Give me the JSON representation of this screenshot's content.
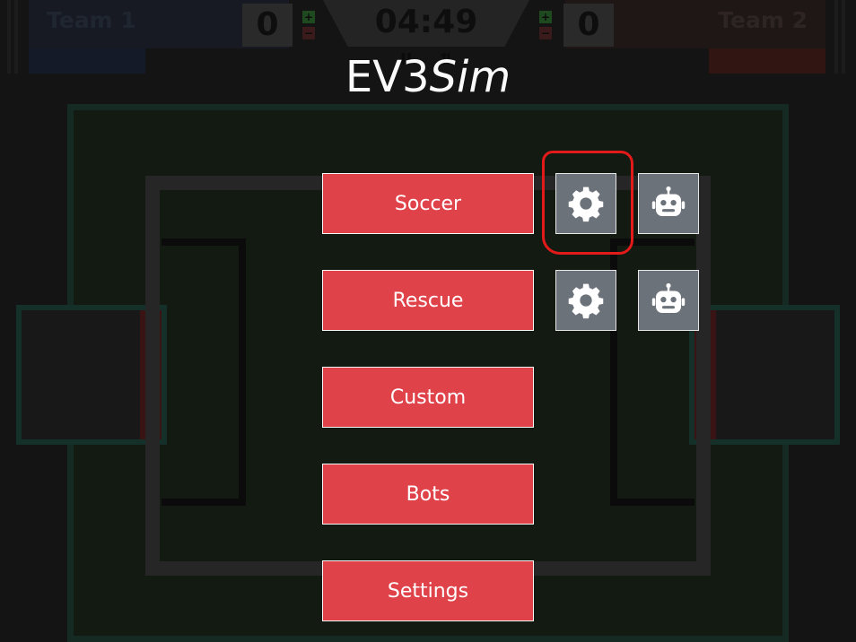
{
  "scoreboard": {
    "team1_name": "Team 1",
    "team2_name": "Team 2",
    "team1_score": "0",
    "team2_score": "0",
    "timer": "04:49",
    "team1_color": "#3b5bb0",
    "team2_color": "#c0392b",
    "plus_symbol": "+",
    "minus_symbol": "−",
    "pause_symbol": "II",
    "reset_symbol": "⇅"
  },
  "menu": {
    "title_prefix": "EV3",
    "title_suffix": "Sim",
    "buttons": [
      {
        "label": "Soccer"
      },
      {
        "label": "Rescue"
      },
      {
        "label": "Custom"
      },
      {
        "label": "Bots"
      },
      {
        "label": "Settings"
      }
    ],
    "icons": {
      "settings_icon": "gear-icon",
      "bot_icon": "robot-icon"
    }
  },
  "colors": {
    "button_red": "#e0424a",
    "icon_button_gray": "#6c727a",
    "highlight_red": "#e21a1a",
    "title_white": "#fafafa"
  }
}
